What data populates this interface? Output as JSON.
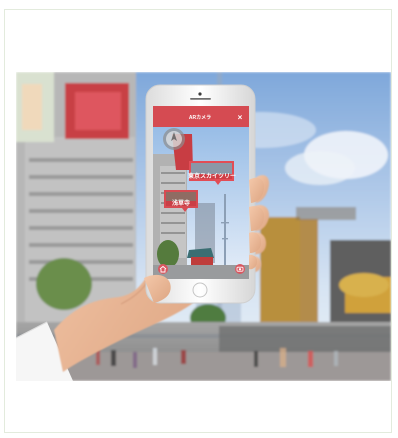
{
  "image": {
    "description": "",
    "phone": {
      "header_title": "ARカメラ",
      "labels": [
        {
          "text": "東京スカイツリー"
        },
        {
          "text": "浅草寺"
        }
      ],
      "controls": {
        "close": "×",
        "left_icon": "home-icon",
        "right_icon": "camera-icon"
      }
    },
    "colors": {
      "sky_top": "#7fa8db",
      "sky_bottom": "#d7e4f3",
      "accent_red": "#d44a52",
      "building_gray": "#b8b8b8",
      "gold": "#c49a38",
      "frame_border": "#e3ebdd"
    }
  }
}
